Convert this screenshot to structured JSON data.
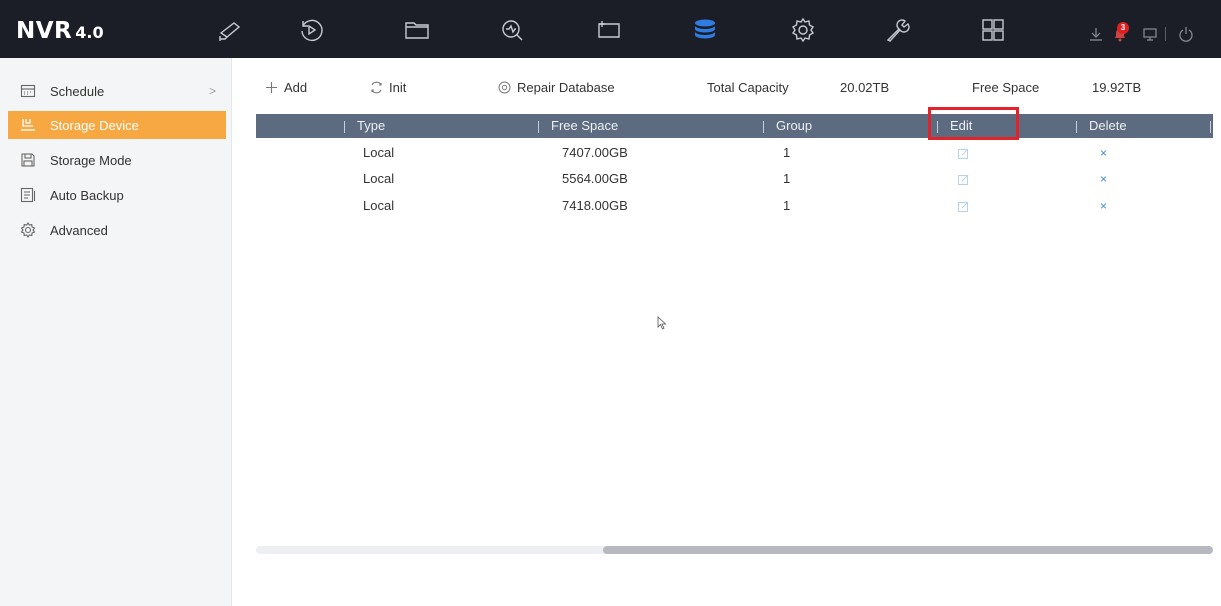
{
  "app": {
    "logo_main": "NVR",
    "logo_version": "4.0",
    "alarm_count": "3"
  },
  "nav_icons": [
    "live-view-camera-icon",
    "playback-icon",
    "file-folder-icon",
    "smart-analysis-icon",
    "display-screen-icon",
    "storage-database-icon",
    "configuration-gear-icon",
    "maintenance-wrench-icon",
    "layout-grid-icon"
  ],
  "active_nav": "storage-database-icon",
  "sidebar": {
    "items": [
      {
        "label": "Schedule",
        "icon": "calendar-icon",
        "chevron": ">"
      },
      {
        "label": "Storage Device",
        "icon": "storage-device-icon"
      },
      {
        "label": "Storage Mode",
        "icon": "save-disk-icon"
      },
      {
        "label": "Auto Backup",
        "icon": "backup-icon"
      },
      {
        "label": "Advanced",
        "icon": "gear-icon"
      }
    ]
  },
  "toolbar": {
    "add": "Add",
    "init": "Init",
    "repair": "Repair Database",
    "total_capacity_label": "Total Capacity",
    "total_capacity_value": "20.02TB",
    "free_space_label": "Free Space",
    "free_space_value": "19.92TB"
  },
  "table": {
    "headers": {
      "type": "Type",
      "free_space": "Free Space",
      "group": "Group",
      "edit": "Edit",
      "delete": "Delete"
    },
    "rows": [
      {
        "type": "Local",
        "free_space": "7407.00GB",
        "group": "1",
        "delete": "×"
      },
      {
        "type": "Local",
        "free_space": "5564.00GB",
        "group": "1",
        "delete": "×"
      },
      {
        "type": "Local",
        "free_space": "7418.00GB",
        "group": "1",
        "delete": "×"
      }
    ]
  },
  "colors": {
    "topbar": "#1b1d27",
    "active_sidebar": "#f7a842",
    "table_header": "#5c6b7f",
    "highlight": "#e3222a",
    "active_nav": "#2f7de1"
  }
}
